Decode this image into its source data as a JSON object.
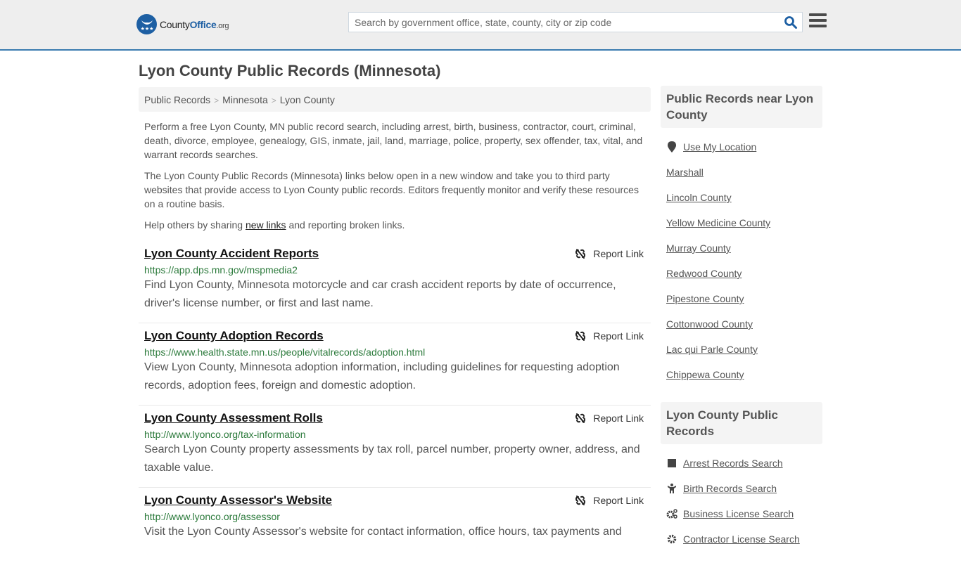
{
  "header": {
    "logo": {
      "county": "County",
      "office": "Office",
      "org": ".org"
    },
    "search_placeholder": "Search by government office, state, county, city or zip code",
    "search_value": ""
  },
  "colors": {
    "brand": "#1d5fa3",
    "header_border": "#3b7cb0",
    "url_green": "#2b7a3b"
  },
  "page_title": "Lyon County Public Records (Minnesota)",
  "breadcrumb": [
    "Public Records",
    "Minnesota",
    "Lyon County"
  ],
  "intro": {
    "p1": "Perform a free Lyon County, MN public record search, including arrest, birth, business, contractor, court, criminal, death, divorce, employee, genealogy, GIS, inmate, jail, land, marriage, police, property, sex offender, tax, vital, and warrant records searches.",
    "p2": "The Lyon County Public Records (Minnesota) links below open in a new window and take you to third party websites that provide access to Lyon County public records. Editors frequently monitor and verify these resources on a routine basis.",
    "p3_before": "Help others by sharing ",
    "p3_link": "new links",
    "p3_after": " and reporting broken links."
  },
  "report_label": "Report Link",
  "records": [
    {
      "title": "Lyon County Accident Reports",
      "url": "https://app.dps.mn.gov/mspmedia2",
      "desc": "Find Lyon County, Minnesota motorcycle and car crash accident reports by date of occurrence, driver's license number, or first and last name."
    },
    {
      "title": "Lyon County Adoption Records",
      "url": "https://www.health.state.mn.us/people/vitalrecords/adoption.html",
      "desc": "View Lyon County, Minnesota adoption information, including guidelines for requesting adoption records, adoption fees, foreign and domestic adoption."
    },
    {
      "title": "Lyon County Assessment Rolls",
      "url": "http://www.lyonco.org/tax-information",
      "desc": "Search Lyon County property assessments by tax roll, parcel number, property owner, address, and taxable value."
    },
    {
      "title": "Lyon County Assessor's Website",
      "url": "http://www.lyonco.org/assessor",
      "desc": "Visit the Lyon County Assessor's website for contact information, office hours, tax payments and"
    }
  ],
  "sidebar": {
    "nearby": {
      "heading": "Public Records near Lyon County",
      "use_location": "Use My Location",
      "items": [
        "Marshall",
        "Lincoln County",
        "Yellow Medicine County",
        "Murray County",
        "Redwood County",
        "Pipestone County",
        "Cottonwood County",
        "Lac qui Parle County",
        "Chippewa County"
      ]
    },
    "county_records": {
      "heading": "Lyon County Public Records",
      "items": [
        {
          "label": "Arrest Records Search",
          "icon": "square-icon"
        },
        {
          "label": "Birth Records Search",
          "icon": "child-icon"
        },
        {
          "label": "Business License Search",
          "icon": "gears-icon"
        },
        {
          "label": "Contractor License Search",
          "icon": "gear-icon"
        }
      ]
    }
  }
}
